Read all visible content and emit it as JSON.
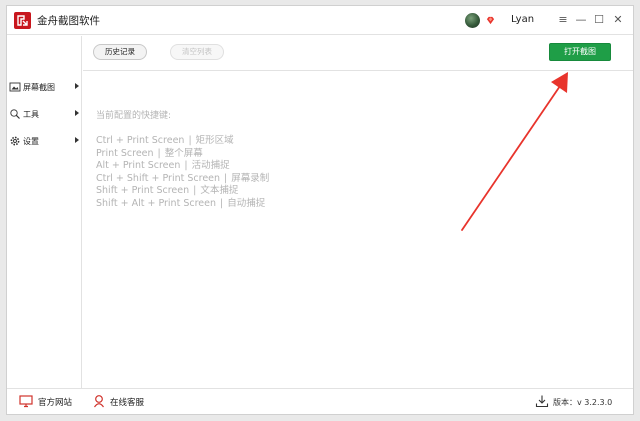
{
  "titlebar": {
    "app_title": "金舟截图软件",
    "username": "Lyan",
    "menu_glyph": "≡",
    "minimize_glyph": "—",
    "maximize_glyph": "☐",
    "close_glyph": "✕"
  },
  "sidebar": {
    "items": [
      {
        "label": "屏幕截图",
        "icon": "screenshot-icon"
      },
      {
        "label": "工具",
        "icon": "tools-icon"
      },
      {
        "label": "设置",
        "icon": "gear-icon"
      }
    ]
  },
  "toolbar": {
    "history_label": "历史记录",
    "clear_label": "清空列表",
    "open_label": "打开截图"
  },
  "content": {
    "heading": "当前配置的快捷键:",
    "shortcuts": [
      {
        "keys": "Ctrl + Print Screen",
        "action": "矩形区域"
      },
      {
        "keys": "Print Screen",
        "action": "整个屏幕"
      },
      {
        "keys": "Alt + Print Screen",
        "action": "活动捕捉"
      },
      {
        "keys": "Ctrl + Shift + Print Screen",
        "action": "屏幕录制"
      },
      {
        "keys": "Shift + Print Screen",
        "action": "文本捕捉"
      },
      {
        "keys": "Shift + Alt + Print Screen",
        "action": "自动捕捉"
      }
    ],
    "separator": "|"
  },
  "statusbar": {
    "website_label": "官方网站",
    "support_label": "在线客服",
    "version_label": "版本：v 3.2.3.0"
  },
  "colors": {
    "accent_green": "#1f9e47",
    "brand_red": "#c8161d",
    "annotation_red": "#e8342c",
    "muted_text": "#b4b4b4"
  }
}
